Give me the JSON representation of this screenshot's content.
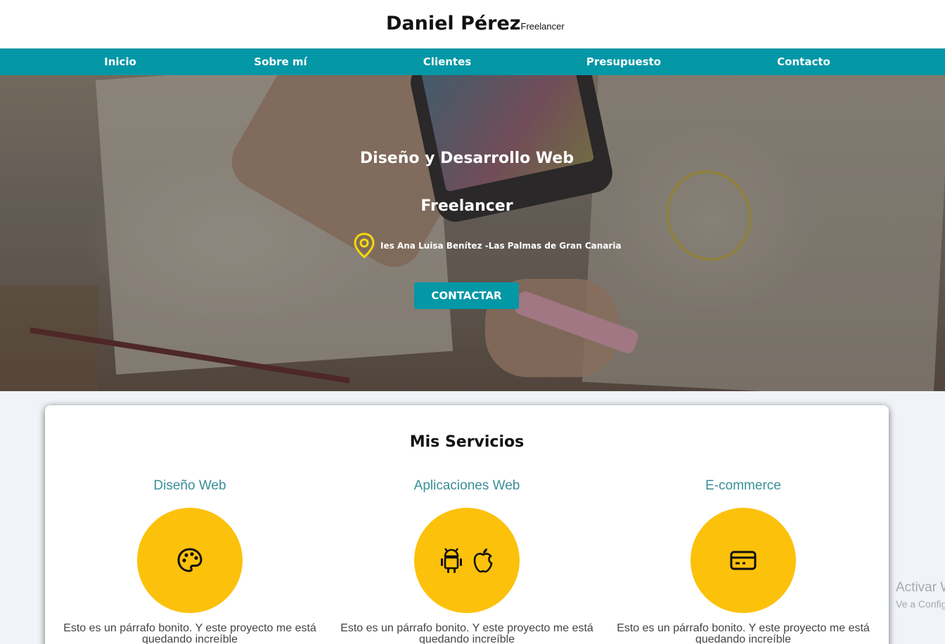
{
  "header": {
    "name": "Daniel Pérez",
    "tagline": "Freelancer"
  },
  "nav": [
    {
      "label": "Inicio"
    },
    {
      "label": "Sobre mí"
    },
    {
      "label": "Clientes"
    },
    {
      "label": "Presupuesto"
    },
    {
      "label": "Contacto"
    }
  ],
  "hero": {
    "title": "Diseño y Desarrollo Web",
    "subtitle": "Freelancer",
    "location": "Ies Ana Luisa Benítez -Las Palmas de Gran Canaria",
    "location_icon": "map-pin-icon",
    "cta_label": "CONTACTAR"
  },
  "services": {
    "title": "Mis Servicios",
    "items": [
      {
        "title": "Diseño Web",
        "icon": "palette-icon",
        "text": "Esto es un párrafo bonito. Y este proyecto me está quedando increíble"
      },
      {
        "title": "Aplicaciones Web",
        "icon": "android-apple-icons",
        "text": "Esto es un párrafo bonito. Y este proyecto me está quedando increíble"
      },
      {
        "title": "E-commerce",
        "icon": "credit-card-icon",
        "text": "Esto es un párrafo bonito. Y este proyecto me está quedando increíble"
      }
    ]
  },
  "watermark": {
    "line1": "Activar W",
    "line2": "Ve a Config"
  },
  "colors": {
    "primary": "#0497a6",
    "accent": "#fcc10b",
    "service_title": "#3a8f98",
    "pin": "#f5d90a"
  }
}
